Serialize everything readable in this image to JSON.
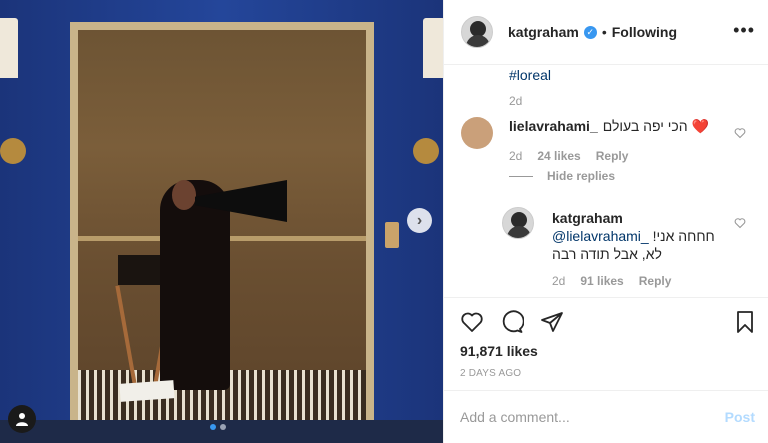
{
  "header": {
    "username": "katgraham",
    "follow_label": "Following",
    "bullet": "•",
    "more_label": "•••"
  },
  "caption": {
    "hashtag": "#loreal",
    "time": "2d"
  },
  "comments": [
    {
      "username": "lielavrahami_",
      "text": "הכי יפה בעולם ❤️",
      "time": "2d",
      "likes": "24 likes",
      "reply_label": "Reply"
    }
  ],
  "hide_replies_label": "Hide replies",
  "reply": {
    "username": "katgraham",
    "mention": "@lielavrahami_",
    "text_line1": "חחחה אני!",
    "text_line2": "לא, אבל תודה רבה",
    "time": "2d",
    "likes": "91 likes",
    "reply_label": "Reply"
  },
  "post": {
    "likes": "91,871 likes",
    "posted": "2 DAYS AGO"
  },
  "add_comment": {
    "placeholder": "Add a comment...",
    "post_label": "Post"
  },
  "media": {
    "next_label": "›",
    "active_slide": 1,
    "slide_count": 2
  },
  "colors": {
    "accent": "#3897f0",
    "hashtag": "#003569",
    "muted": "#999999",
    "post_disabled": "#b3dbff"
  }
}
